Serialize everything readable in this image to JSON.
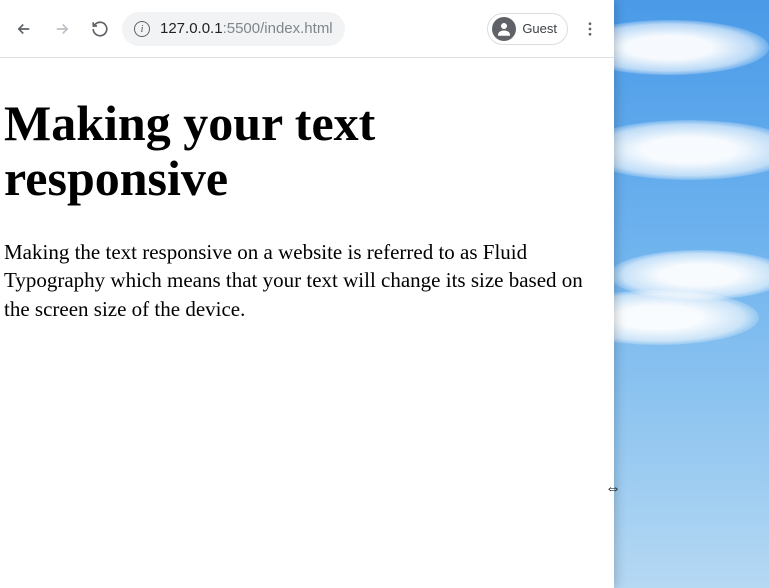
{
  "toolbar": {
    "url_host": "127.0.0.1",
    "url_port": ":5500",
    "url_path": "/index.html",
    "profile_label": "Guest"
  },
  "page": {
    "heading": "Making your text responsive",
    "paragraph": "Making the text responsive on a website is referred to as Fluid Typography which means that your text will change its size based on the screen size of the device."
  }
}
